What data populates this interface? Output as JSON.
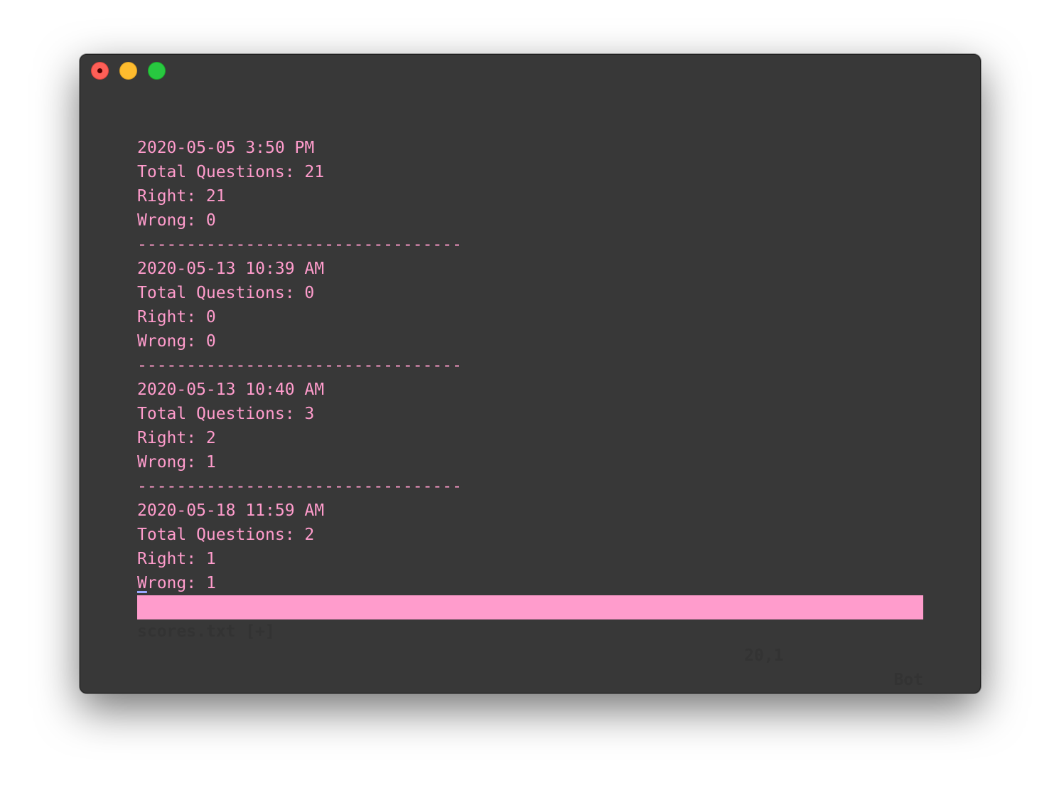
{
  "window": {
    "controls": [
      "close",
      "minimize",
      "maximize"
    ],
    "colors": {
      "background": "#383838",
      "text": "#ff9ccc",
      "statusline_bg": "#ff9ccc",
      "statusline_text": "#333333"
    }
  },
  "buffer": {
    "lines": [
      "2020-05-05 3:50 PM",
      "Total Questions: 21",
      "Right: 21",
      "Wrong: 0",
      "---------------------------------",
      "2020-05-13 10:39 AM",
      "Total Questions: 0",
      "Right: 0",
      "Wrong: 0",
      "---------------------------------",
      "2020-05-13 10:40 AM",
      "Total Questions: 3",
      "Right: 2",
      "Wrong: 1",
      "---------------------------------",
      "2020-05-18 11:59 AM",
      "Total Questions: 2",
      "Right: 1"
    ],
    "cursor_line": {
      "cursor_char": "W",
      "rest": "rong: 1"
    }
  },
  "statusline": {
    "filename": "scores.txt [+]",
    "position": "20,1",
    "scroll": "Bot"
  }
}
